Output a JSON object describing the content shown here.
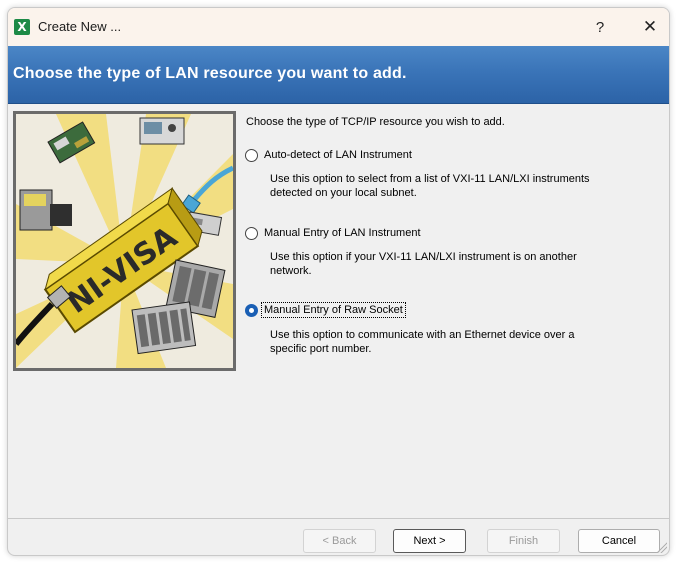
{
  "window": {
    "title": "Create New ...",
    "help_glyph": "?",
    "close_glyph": "✕",
    "app_icon_glyph": "X",
    "app_icon": "excel-like-green-icon"
  },
  "banner": {
    "title": "Choose the type of LAN resource you want to add."
  },
  "illustration": {
    "brand_text": "NI-VISA"
  },
  "main": {
    "prompt": "Choose the type of TCP/IP resource you wish to add.",
    "options": [
      {
        "label": "Auto-detect of LAN Instrument",
        "description": "Use this option to select from a list of VXI-11 LAN/LXI instruments detected on your local subnet.",
        "selected": false
      },
      {
        "label": "Manual Entry of LAN Instrument",
        "description": "Use this option if your VXI-11 LAN/LXI instrument is on another network.",
        "selected": false
      },
      {
        "label": "Manual Entry of Raw Socket",
        "description": "Use this option to communicate with an Ethernet device over a specific port number.",
        "selected": true
      }
    ]
  },
  "footer": {
    "back_label": "< Back",
    "next_label": "Next >",
    "finish_label": "Finish",
    "cancel_label": "Cancel"
  },
  "colors": {
    "banner": "#3a74b8",
    "app_icon": "#1d8a46",
    "radio_selected": "#1a5fb4",
    "illustration_key": "#e2c62a"
  }
}
